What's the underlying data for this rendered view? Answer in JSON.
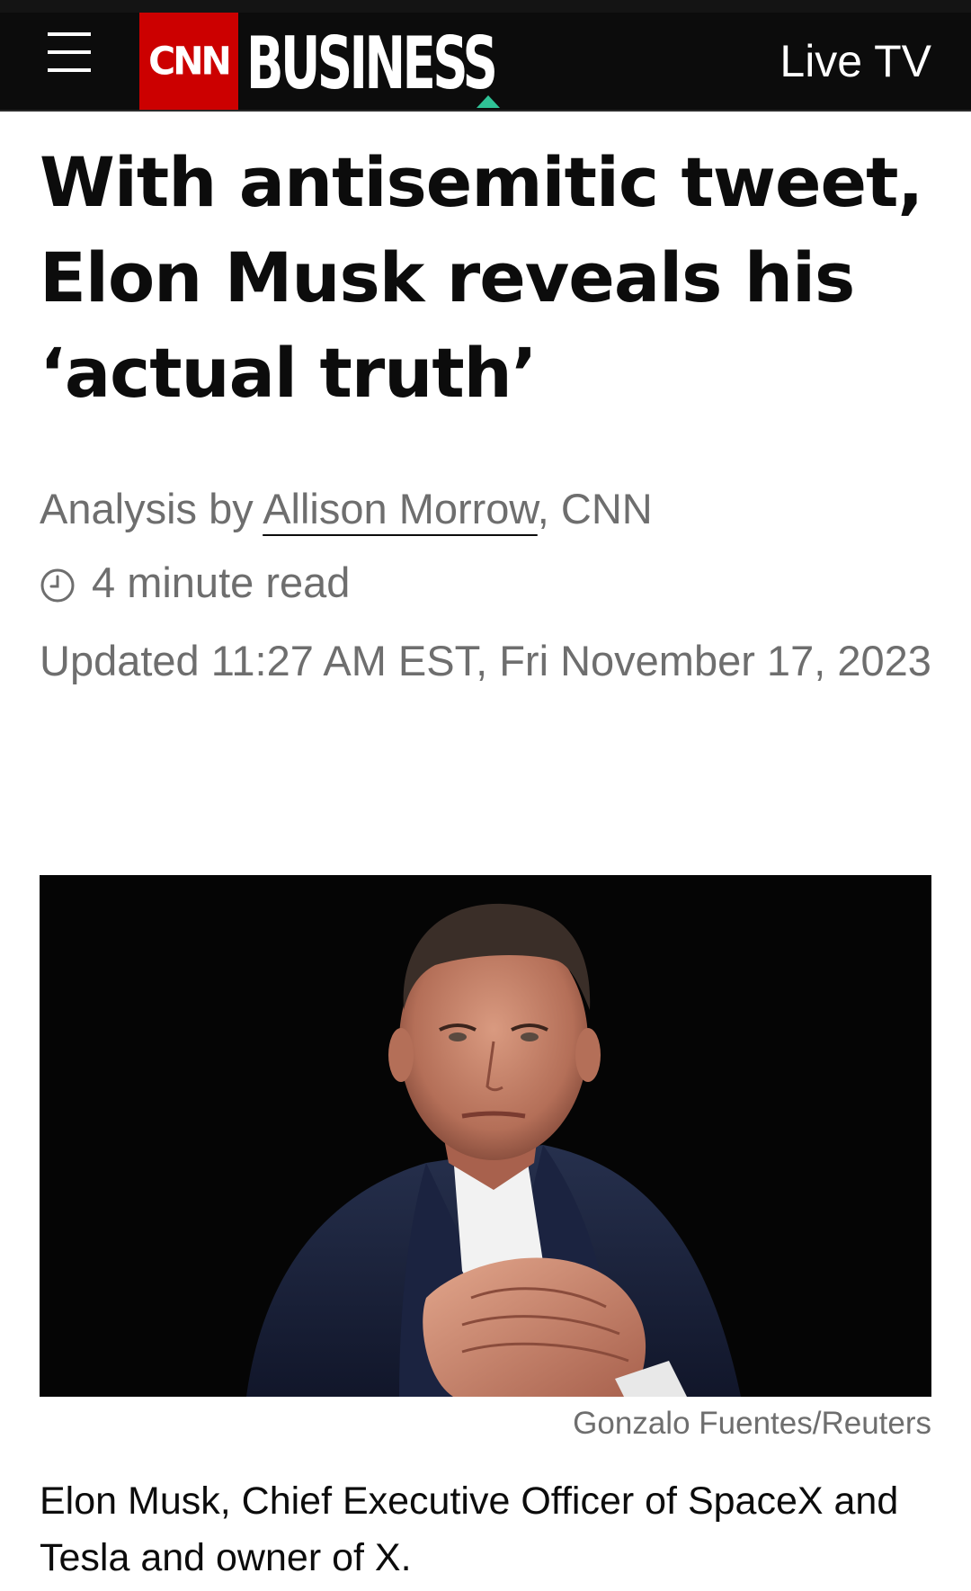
{
  "header": {
    "logo_text": "CNN",
    "section": "BUSINESS",
    "live_tv_label": "Live TV",
    "colors": {
      "background": "#0c0c0c",
      "logo_red": "#cc0000",
      "accent": "#2fc296"
    }
  },
  "article": {
    "headline": "With antisemitic tweet, Elon Musk reveals his ‘actual truth’",
    "byline_prefix": "Analysis by ",
    "author": "Allison Morrow",
    "byline_suffix": ", CNN",
    "read_time": "4 minute read",
    "timestamp": "Updated 11:27 AM EST, Fri November 17, 2023"
  },
  "photo": {
    "credit": "Gonzalo Fuentes/Reuters",
    "caption": "Elon Musk, Chief Executive Officer of SpaceX and Tesla and owner of X."
  }
}
